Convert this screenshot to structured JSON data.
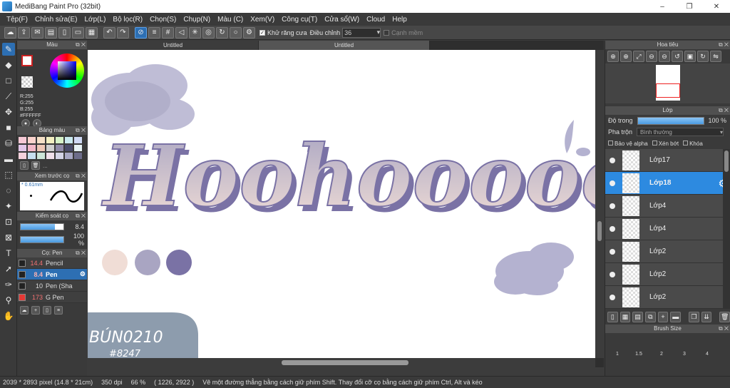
{
  "window": {
    "title": "MediBang Paint Pro (32bit)",
    "controls": [
      "–",
      "❐",
      "✕"
    ]
  },
  "menu": [
    "Tệp(F)",
    "Chỉnh sửa(E)",
    "Lớp(L)",
    "Bộ lọc(R)",
    "Chọn(S)",
    "Chụp(N)",
    "Màu (C)",
    "Xem(V)",
    "Công cụ(T)",
    "Cửa sổ(W)",
    "Cloud",
    "Help"
  ],
  "toolbar": {
    "antialias_label": "Khử răng cưa",
    "adjust_label": "Điều chỉnh",
    "adjust_value": "36",
    "edge_label": "Cạnh mềm"
  },
  "left": {
    "color_panel_title": "Màu",
    "rgb_r": "R:255",
    "rgb_g": "G:255",
    "rgb_b": "B:255",
    "hex": "#FFFFFF",
    "palette_title": "Bảng màu",
    "palette_colors": [
      "#f6c9d5",
      "#fbd3cd",
      "#f6e0c7",
      "#f3efc1",
      "#d6f2c7",
      "#c9e9ef",
      "#cfd9f4",
      "#e2c6e8",
      "#f3b8c8",
      "#eec7b6",
      "#cfcfcf",
      "#8f8aa8",
      "#4a4c6a",
      "#e6f2f4",
      "#f5d2dc",
      "#c7dfef",
      "#cde6d8",
      "#f0e0ea",
      "#d4d4e6",
      "#a8a8c4",
      "#6d6d8a"
    ],
    "palette_more": "...",
    "preview_title": "Xem trước cọ",
    "preview_size": "0.61mm",
    "control_title": "Kiểm soát cọ",
    "size_value": "8.4",
    "size_fraction": 0.8,
    "opacity_value": "100 %",
    "opacity_fraction": 1.0,
    "brush_title": "Cọ: Pen",
    "brushes": [
      {
        "size": "14.4",
        "name": "Pencil",
        "swatch": "#222222"
      },
      {
        "size": "8.4",
        "name": "Pen",
        "swatch": "#222222"
      },
      {
        "size": "10",
        "name": "Pen (Sha",
        "swatch": "#222222"
      },
      {
        "size": "173",
        "name": "G Pen",
        "swatch": "#e53935"
      }
    ]
  },
  "canvas": {
    "tabs": [
      "Untitled",
      "Untitled"
    ],
    "lettering": "Hoohoooooi",
    "signature_line1": "BÚN0210",
    "signature_line2": "#8247",
    "colors": {
      "light": "#f0ddd6",
      "mid": "#a9a5c2",
      "dark": "#7a72a5",
      "blob": "#b4b2d0",
      "tag": "#8d9cad"
    }
  },
  "right": {
    "navigator_title": "Hoa tiêu",
    "layer_title": "Lớp",
    "opacity_label": "Độ trong",
    "opacity_value": "100 %",
    "blend_label": "Pha trộn",
    "blend_value": "Bình thường",
    "protect_alpha": "Bảo vệ alpha",
    "clipping": "Xén bớt",
    "lock": "Khóa",
    "layers": [
      "Lớp17",
      "Lớp18",
      "Lớp4",
      "Lớp4",
      "Lớp2",
      "Lớp2",
      "Lớp2"
    ],
    "brush_size_title": "Brush Size",
    "brush_sizes": [
      "1",
      "1.5",
      "2",
      "3",
      "4"
    ]
  },
  "status": {
    "dimensions": "2039 * 2893 pixel",
    "physical": "(14.8 * 21cm)",
    "dpi": "350 dpi",
    "zoom": "66 %",
    "coords": "( 1226, 2922 )",
    "hint": "Vẽ một đường thẳng bằng cách giữ phím Shift. Thay đổi cỡ cọ bằng cách giữ phím Ctrl, Alt và kéo"
  }
}
